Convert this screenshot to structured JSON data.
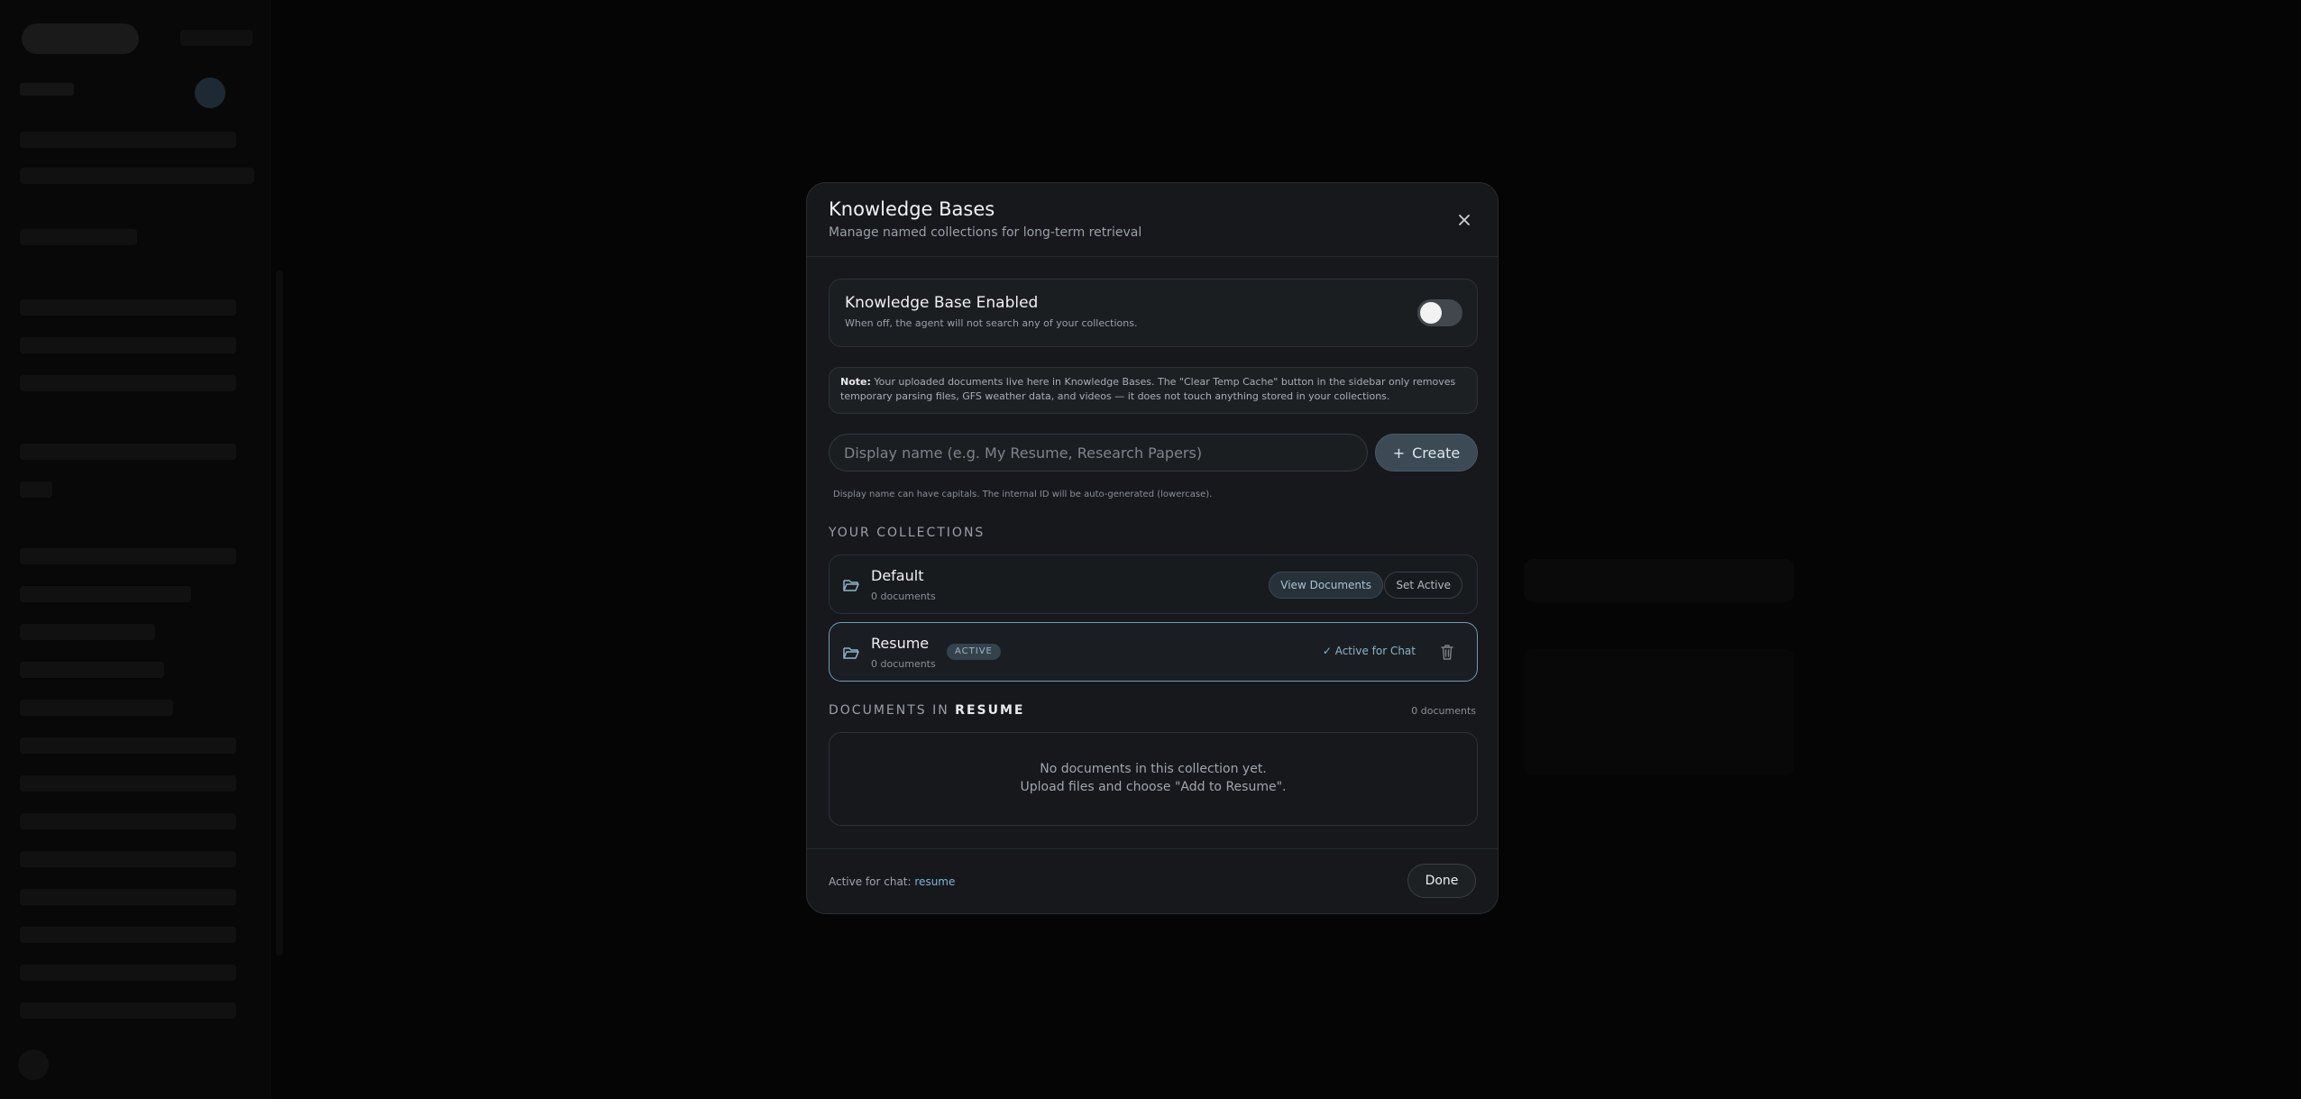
{
  "modal": {
    "title": "Knowledge Bases",
    "subtitle": "Manage named collections for long-term retrieval",
    "close_icon": "close-icon"
  },
  "toggle": {
    "title": "Knowledge Base Enabled",
    "description": "When off, the agent will not search any of your collections.",
    "enabled": false
  },
  "note": {
    "label": "Note:",
    "text": "Your uploaded documents live here in Knowledge Bases. The \"Clear Temp Cache\" button in the sidebar only removes temporary parsing files, GFS weather data, and videos — it does not touch anything stored in your collections."
  },
  "create": {
    "placeholder": "Display name (e.g. My Resume, Research Papers)",
    "value": "",
    "button_label": "Create",
    "hint": "Display name can have capitals. The internal ID will be auto-generated (lowercase)."
  },
  "collections_label": "YOUR COLLECTIONS",
  "collections": [
    {
      "name": "Default",
      "count": "0 documents",
      "view_label": "View Documents",
      "set_active_label": "Set Active"
    },
    {
      "name": "Resume",
      "count": "0 documents",
      "badge": "ACTIVE",
      "active_label": "Active for Chat"
    }
  ],
  "documents": {
    "label_prefix": "DOCUMENTS IN",
    "collection": "RESUME",
    "count": "0 documents",
    "empty_line1": "No documents in this collection yet.",
    "empty_line2": "Upload files and choose \"Add to Resume\"."
  },
  "footer": {
    "active_label": "Active for chat:",
    "active_value": "resume",
    "done_label": "Done"
  },
  "colors": {
    "accent": "#7fb5d6",
    "active_border": "#6f9bb4",
    "modal_bg": "#16181b"
  }
}
